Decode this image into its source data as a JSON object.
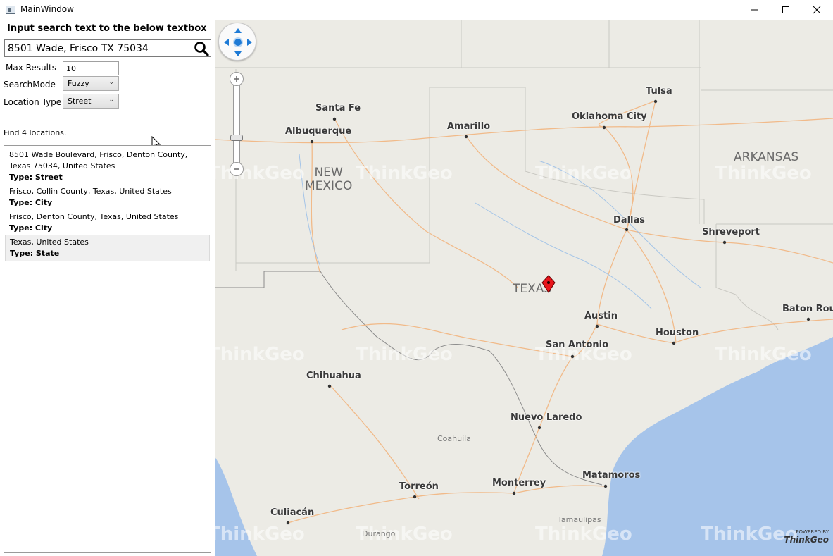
{
  "window": {
    "title": "MainWindow"
  },
  "panel": {
    "prompt": "Input search text to the below textbox",
    "search_value": "8501 Wade, Frisco TX 75034",
    "max_results_label": "Max Results",
    "max_results_value": "10",
    "search_mode_label": "SearchMode",
    "search_mode_value": "Fuzzy",
    "location_type_label": "Location Type",
    "location_type_value": "Street",
    "result_count_text": "Find 4 locations."
  },
  "results": [
    {
      "address": "8501 Wade Boulevard, Frisco, Denton County, Texas 75034, United States",
      "type": "Type: Street"
    },
    {
      "address": "Frisco, Collin County, Texas, United States",
      "type": "Type: City"
    },
    {
      "address": "Frisco, Denton County, Texas, United States",
      "type": "Type: City"
    },
    {
      "address": "Texas, United States",
      "type": "Type: State"
    }
  ],
  "map": {
    "cities": [
      "Santa Fe",
      "Albuquerque",
      "Amarillo",
      "Oklahoma City",
      "Tulsa",
      "Dallas",
      "Shreveport",
      "Austin",
      "Houston",
      "San Antonio",
      "Baton Roug",
      "Chihuahua",
      "Nuevo Laredo",
      "Monterrey",
      "Matamoros",
      "Torreón",
      "Culiacán"
    ],
    "states": [
      "NEW\nMEXICO",
      "TEXAS",
      "ARKANSAS"
    ],
    "regions": [
      "Coahuila",
      "Tamaulipas",
      "Durango"
    ],
    "watermark": "ThinkGeo",
    "logo_powered": "POWERED BY",
    "logo_brand": "ThinkGeo"
  },
  "colors": {
    "land": "#ecebe5",
    "water": "#a6c4ea",
    "road": "#f2b27a",
    "marker": "#e8141b"
  }
}
